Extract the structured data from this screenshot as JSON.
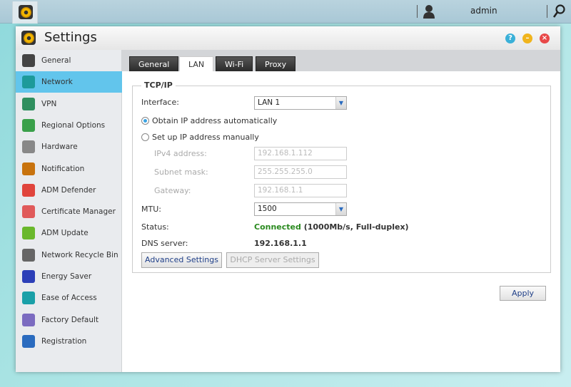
{
  "topbar": {
    "user": "admin"
  },
  "window": {
    "title": "Settings"
  },
  "sidebar": {
    "items": [
      {
        "label": "General",
        "icon": "server-icon",
        "color": "#444"
      },
      {
        "label": "Network",
        "icon": "globe-network-icon",
        "color": "#1d9a9a"
      },
      {
        "label": "VPN",
        "icon": "house-network-icon",
        "color": "#2f8f5f"
      },
      {
        "label": "Regional Options",
        "icon": "globe-pin-icon",
        "color": "#3aa04a"
      },
      {
        "label": "Hardware",
        "icon": "hardware-icon",
        "color": "#888"
      },
      {
        "label": "Notification",
        "icon": "alert-icon",
        "color": "#c8730e"
      },
      {
        "label": "ADM Defender",
        "icon": "firewall-icon",
        "color": "#e0443c"
      },
      {
        "label": "Certificate Manager",
        "icon": "certificate-icon",
        "color": "#e05a5a"
      },
      {
        "label": "ADM Update",
        "icon": "arrow-up-icon",
        "color": "#6ab82c"
      },
      {
        "label": "Network Recycle Bin",
        "icon": "trash-icon",
        "color": "#666"
      },
      {
        "label": "Energy Saver",
        "icon": "lightning-icon",
        "color": "#2c3fb8"
      },
      {
        "label": "Ease of Access",
        "icon": "cloud-upload-icon",
        "color": "#1aa0a8"
      },
      {
        "label": "Factory Default",
        "icon": "undo-icon",
        "color": "#7b6bc0"
      },
      {
        "label": "Registration",
        "icon": "registration-icon",
        "color": "#2a6bbf"
      }
    ],
    "active": 1
  },
  "tabs": [
    "General",
    "LAN",
    "Wi-Fi",
    "Proxy"
  ],
  "active_tab": 1,
  "tcpip": {
    "legend": "TCP/IP",
    "interface_label": "Interface:",
    "interface_value": "LAN 1",
    "radio_auto": "Obtain IP address automatically",
    "radio_manual": "Set up IP address manually",
    "ipv4_label": "IPv4 address:",
    "ipv4_value": "192.168.1.112",
    "subnet_label": "Subnet mask:",
    "subnet_value": "255.255.255.0",
    "gateway_label": "Gateway:",
    "gateway_value": "192.168.1.1",
    "mtu_label": "MTU:",
    "mtu_value": "1500",
    "status_label": "Status:",
    "status_value": "Connected",
    "status_detail": " (1000Mb/s, Full-duplex)",
    "dns_label": "DNS server:",
    "dns_value": "192.168.1.1",
    "advanced_btn": "Advanced Settings",
    "dhcp_btn": "DHCP Server Settings"
  },
  "apply": "Apply",
  "colors": {
    "accent": "#62c5ec",
    "connected": "#2a8a1f"
  }
}
